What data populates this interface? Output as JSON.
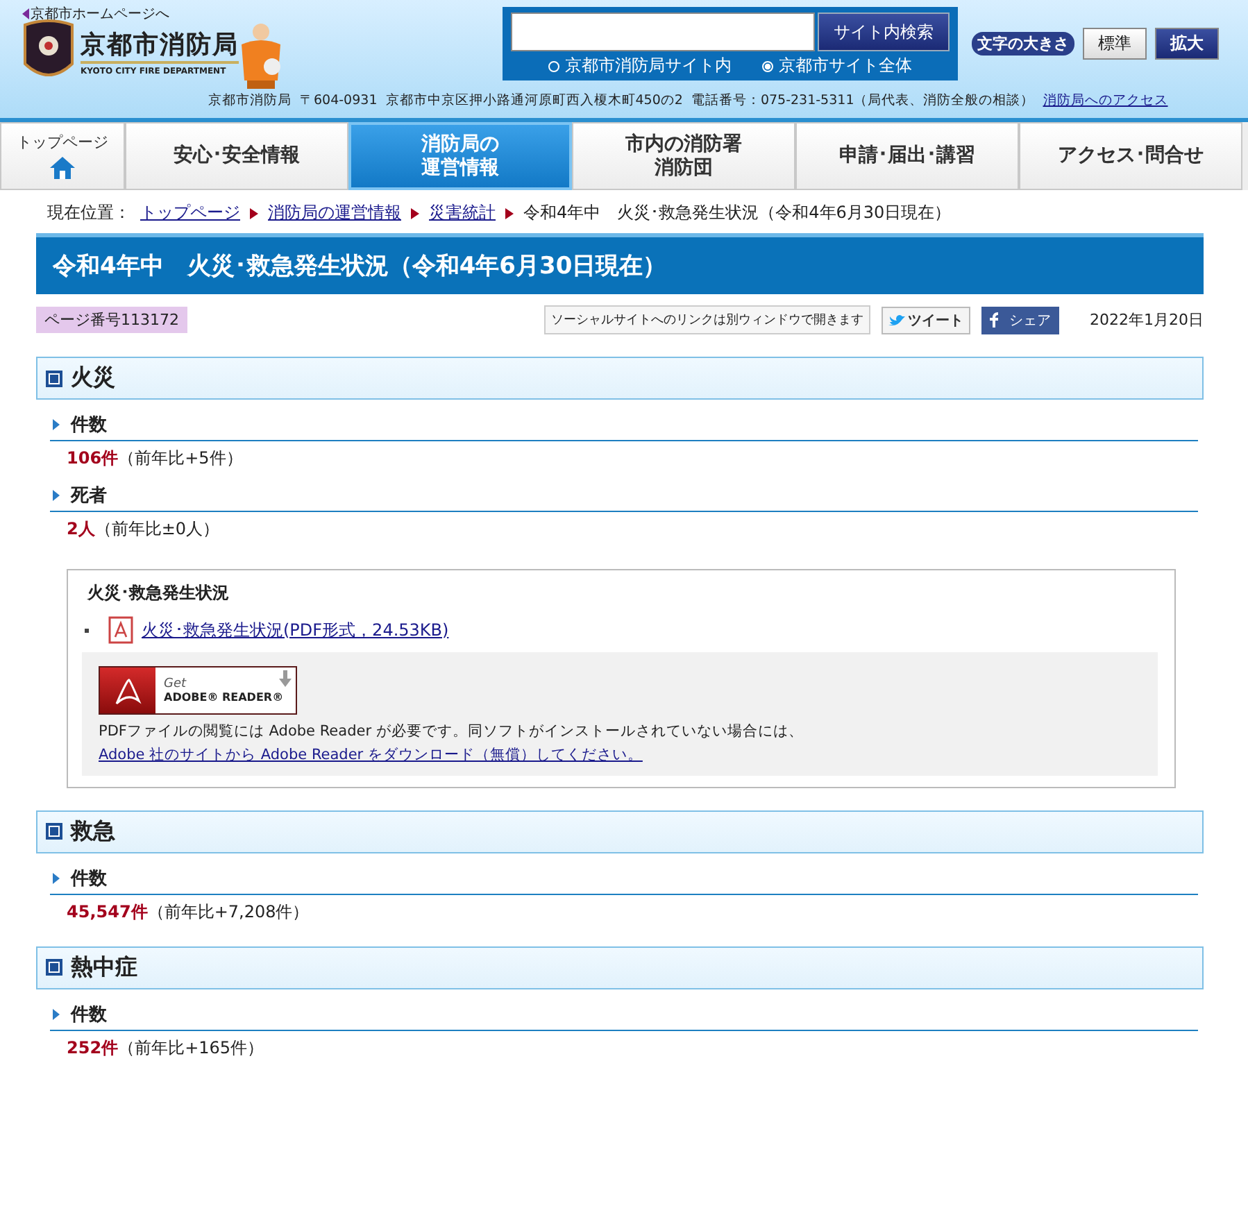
{
  "header": {
    "home_link": "京都市ホームページへ",
    "logo": {
      "name": "京都市消防局",
      "english": "KYOTO CITY FIRE DEPARTMENT"
    },
    "search": {
      "button": "サイト内検索",
      "scopes": [
        {
          "label": "京都市消防局サイト内",
          "selected": false
        },
        {
          "label": "京都市サイト全体",
          "selected": true
        }
      ]
    },
    "font_size": {
      "label": "文字の大きさ",
      "options": [
        {
          "label": "標準",
          "selected": false
        },
        {
          "label": "拡大",
          "selected": true
        }
      ]
    },
    "address": [
      "京都市消防局",
      "〒604-0931",
      "京都市中京区押小路通河原町西入榎木町450の2",
      "電話番号：075-231-5311（局代表、消防全般の相談）"
    ],
    "access_link": "消防局へのアクセス"
  },
  "nav": [
    {
      "kind": "home",
      "lines": [
        "トップページ"
      ],
      "selected": false
    },
    {
      "kind": "text",
      "lines": [
        "安心･安全情報"
      ],
      "selected": false
    },
    {
      "kind": "text",
      "lines": [
        "消防局の",
        "運営情報"
      ],
      "selected": true
    },
    {
      "kind": "text",
      "lines": [
        "市内の消防署",
        "消防団"
      ],
      "selected": false
    },
    {
      "kind": "text",
      "lines": [
        "申請･届出･講習"
      ],
      "selected": false
    },
    {
      "kind": "text",
      "lines": [
        "アクセス･問合せ"
      ],
      "selected": false
    }
  ],
  "breadcrumb": {
    "label": "現在位置：",
    "items": [
      {
        "label": "トップページ",
        "link": true
      },
      {
        "label": "消防局の運営情報",
        "link": true
      },
      {
        "label": "災害統計",
        "link": true
      },
      {
        "label": "令和4年中　火災･救急発生状況（令和4年6月30日現在）",
        "link": false
      }
    ]
  },
  "title": "令和4年中　火災･救急発生状況（令和4年6月30日現在）",
  "meta": {
    "page_number": "ページ番号113172",
    "social_note": "ソーシャルサイトへのリンクは別ウィンドウで開きます",
    "tweet": "ツイート",
    "share": "シェア",
    "date": "2022年1月20日"
  },
  "sections": [
    {
      "heading": "火災",
      "blocks": [
        {
          "kind": "stat",
          "label": "件数",
          "value": "106件",
          "note": "（前年比+5件）"
        },
        {
          "kind": "stat",
          "label": "死者",
          "value": "2人",
          "note": "（前年比±0人）"
        },
        {
          "kind": "box",
          "title": "火災･救急発生状況",
          "file_link": "火災･救急発生状況(PDF形式，24.53KB)",
          "badge_get": "Get",
          "badge_name": "ADOBE® READER®",
          "note": "PDFファイルの閲覧には Adobe Reader が必要です。同ソフトがインストールされていない場合には、",
          "note_link": "Adobe 社のサイトから Adobe Reader をダウンロード（無償）してください。"
        }
      ]
    },
    {
      "heading": "救急",
      "blocks": [
        {
          "kind": "stat",
          "label": "件数",
          "value": "45,547件",
          "note": "（前年比+7,208件）"
        }
      ]
    },
    {
      "heading": "熱中症",
      "blocks": [
        {
          "kind": "stat",
          "label": "件数",
          "value": "252件",
          "note": "（前年比+165件）"
        }
      ]
    }
  ]
}
